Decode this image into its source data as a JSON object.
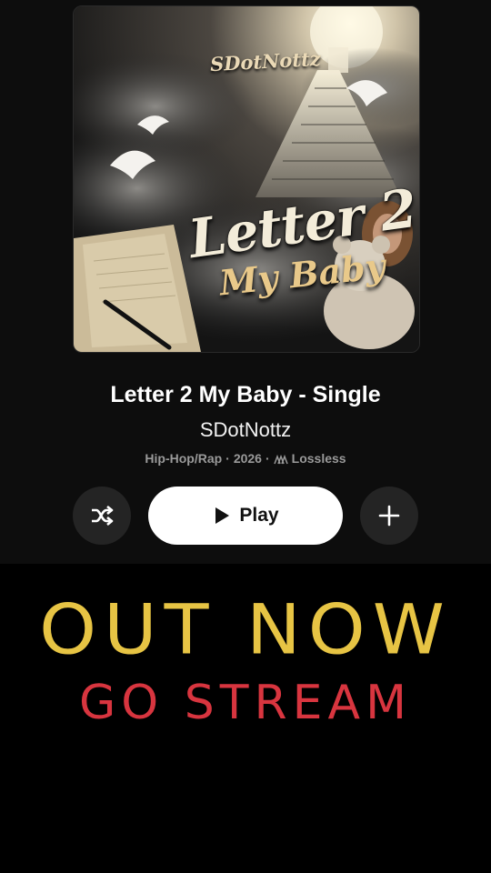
{
  "album": {
    "cover_artist_text": "SDotNottz",
    "cover_title_line1": "Letter 2",
    "cover_title_line2": "My Baby",
    "title": "Letter 2 My Baby - Single",
    "artist": "SDotNottz",
    "genre": "Hip-Hop/Rap",
    "year": "2026",
    "quality": "Lossless"
  },
  "controls": {
    "shuffle_icon": "shuffle-icon",
    "play_label": "Play",
    "add_icon": "plus-icon"
  },
  "promo": {
    "headline": "OUT NOW",
    "subheadline": "GO STREAM",
    "headline_color": "#e7c444",
    "subheadline_color": "#d8353f"
  }
}
